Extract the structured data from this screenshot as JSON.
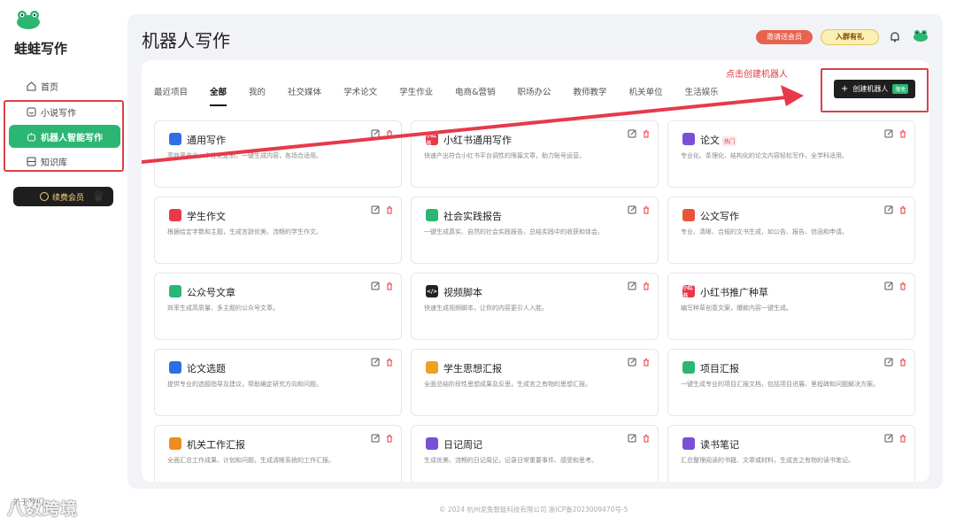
{
  "sidebar": {
    "brand": "蛙蛙写作",
    "items": [
      {
        "label": "首页",
        "icon": "home-icon"
      },
      {
        "label": "小说写作",
        "icon": "book-icon"
      },
      {
        "label": "机器人智能写作",
        "icon": "robot-icon"
      },
      {
        "label": "知识库",
        "icon": "database-icon"
      }
    ],
    "vip_label": "续费会员",
    "bottom_label": "关于我们"
  },
  "header": {
    "title": "机器人写作",
    "invite_label": "邀请送会员",
    "group_label": "入群有礼"
  },
  "tabs": [
    "最近项目",
    "全部",
    "我的",
    "社交媒体",
    "学术论文",
    "学生作业",
    "电商&营销",
    "职场办公",
    "教师教学",
    "机关单位",
    "生活娱乐"
  ],
  "create": {
    "hint": "点击创建机器人",
    "button_label": "创建机器人",
    "badge": "限免"
  },
  "cards": [
    {
      "title": "通用写作",
      "desc": "高效率产出，个性化定制，一键生成内容，各场合适用。",
      "icon_text": "",
      "color": "#2f6fe4",
      "hot": ""
    },
    {
      "title": "小红书通用写作",
      "desc": "快速产出符合小红书平台调性的限篇文章，助力账号运营。",
      "icon_text": "小红书",
      "color": "#e8394a",
      "hot": ""
    },
    {
      "title": "论文",
      "desc": "专业化、条理化、结构化的论文内容轻松写作，全学科适用。",
      "icon_text": "",
      "color": "#7a4fd8",
      "hot": "热门"
    },
    {
      "title": "学生作文",
      "desc": "根据给定字数和主题，生成言辞优美、流畅的学生作文。",
      "icon_text": "",
      "color": "#e8394a",
      "hot": ""
    },
    {
      "title": "社会实践报告",
      "desc": "一键生成真实、自然的社会实践报告，总结实践中的收获和体会。",
      "icon_text": "",
      "color": "#2bb673",
      "hot": ""
    },
    {
      "title": "公文写作",
      "desc": "专业、清晰、合规的文书生成，如公告、报告、信函和申请。",
      "icon_text": "",
      "color": "#e8533a",
      "hot": ""
    },
    {
      "title": "公众号文章",
      "desc": "效率生成高质量、多主题的公众号文章。",
      "icon_text": "",
      "color": "#2bb673",
      "hot": ""
    },
    {
      "title": "视频脚本",
      "desc": "快速生成视频脚本，让你的内容更引人入胜。",
      "icon_text": "</>",
      "color": "#222222",
      "hot": ""
    },
    {
      "title": "小红书推广种草",
      "desc": "编写种草创意文案，爆款内容一键生成。",
      "icon_text": "小红书",
      "color": "#e8394a",
      "hot": ""
    },
    {
      "title": "论文选题",
      "desc": "提供专业的选题指导及建议，帮助确定研究方向和问题。",
      "icon_text": "",
      "color": "#2f6fe4",
      "hot": ""
    },
    {
      "title": "学生思想汇报",
      "desc": "全面总结阶段性思想成果及反思，生成言之有物的思想汇报。",
      "icon_text": "",
      "color": "#f0a020",
      "hot": ""
    },
    {
      "title": "项目汇报",
      "desc": "一键生成专业的项目汇报文档，包括项目进展、里程碑和问题解决方案。",
      "icon_text": "",
      "color": "#2bb673",
      "hot": ""
    },
    {
      "title": "机关工作汇报",
      "desc": "全面汇总工作成果、计划和问题，生成清晰系统的工作汇报。",
      "icon_text": "",
      "color": "#f08a24",
      "hot": ""
    },
    {
      "title": "日记周记",
      "desc": "生成优美、流畅的日记周记，记录日常重要事件、感受和思考。",
      "icon_text": "",
      "color": "#7a4fd8",
      "hot": ""
    },
    {
      "title": "读书笔记",
      "desc": "汇总整理阅读的书籍、文章或材料，生成言之有物的读书笔记。",
      "icon_text": "",
      "color": "#7a4fd8",
      "hot": ""
    }
  ],
  "footer": "© 2024 杭州泥兔智能科技有限公司 浙ICP备2023009470号-5",
  "watermark": "八数跨境",
  "colors": {
    "accent": "#2bb673",
    "highlight": "#d9424a"
  }
}
